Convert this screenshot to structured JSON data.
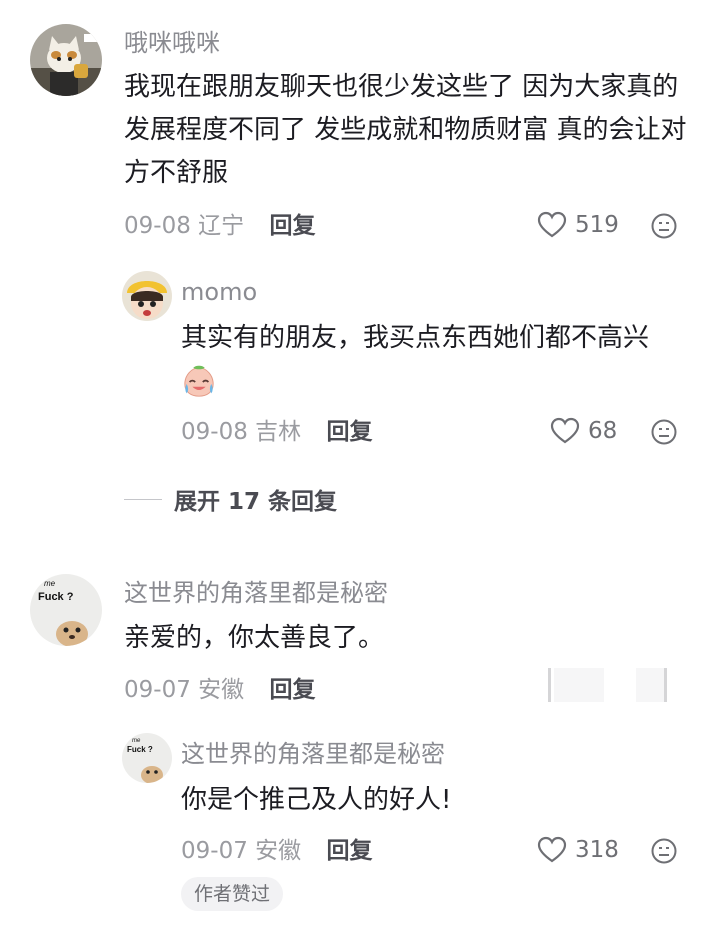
{
  "comments": [
    {
      "user": "哦咪哦咪",
      "text": "我现在跟朋友聊天也很少发这些了 因为大家真的发展程度不同了 发些成就和物质财富 真的会让对方不舒服",
      "date": "09-08",
      "location": "辽宁",
      "reply_label": "回复",
      "likes": "519",
      "replies": [
        {
          "user": "momo",
          "text": "其实有的朋友，我买点东西她们都不高兴",
          "date": "09-08",
          "location": "吉林",
          "reply_label": "回复",
          "likes": "68"
        }
      ],
      "expand_label": "展开 17 条回复"
    },
    {
      "user": "这世界的角落里都是秘密",
      "text": "亲爱的，你太善良了。",
      "date": "09-07",
      "location": "安徽",
      "reply_label": "回复",
      "avatar_text_top": "me",
      "avatar_text_main": "Fuck ?",
      "replies": [
        {
          "user": "这世界的角落里都是秘密",
          "text": "你是个推己及人的好人!",
          "date": "09-07",
          "location": "安徽",
          "reply_label": "回复",
          "likes": "318",
          "avatar_text_top": "me",
          "avatar_text_main": "Fuck ?",
          "badge": "作者赞过"
        }
      ]
    }
  ],
  "icons": {
    "like": "heart-outline-icon",
    "dislike": "frown-face-icon",
    "emoji": "crying-laughing-emoji"
  }
}
